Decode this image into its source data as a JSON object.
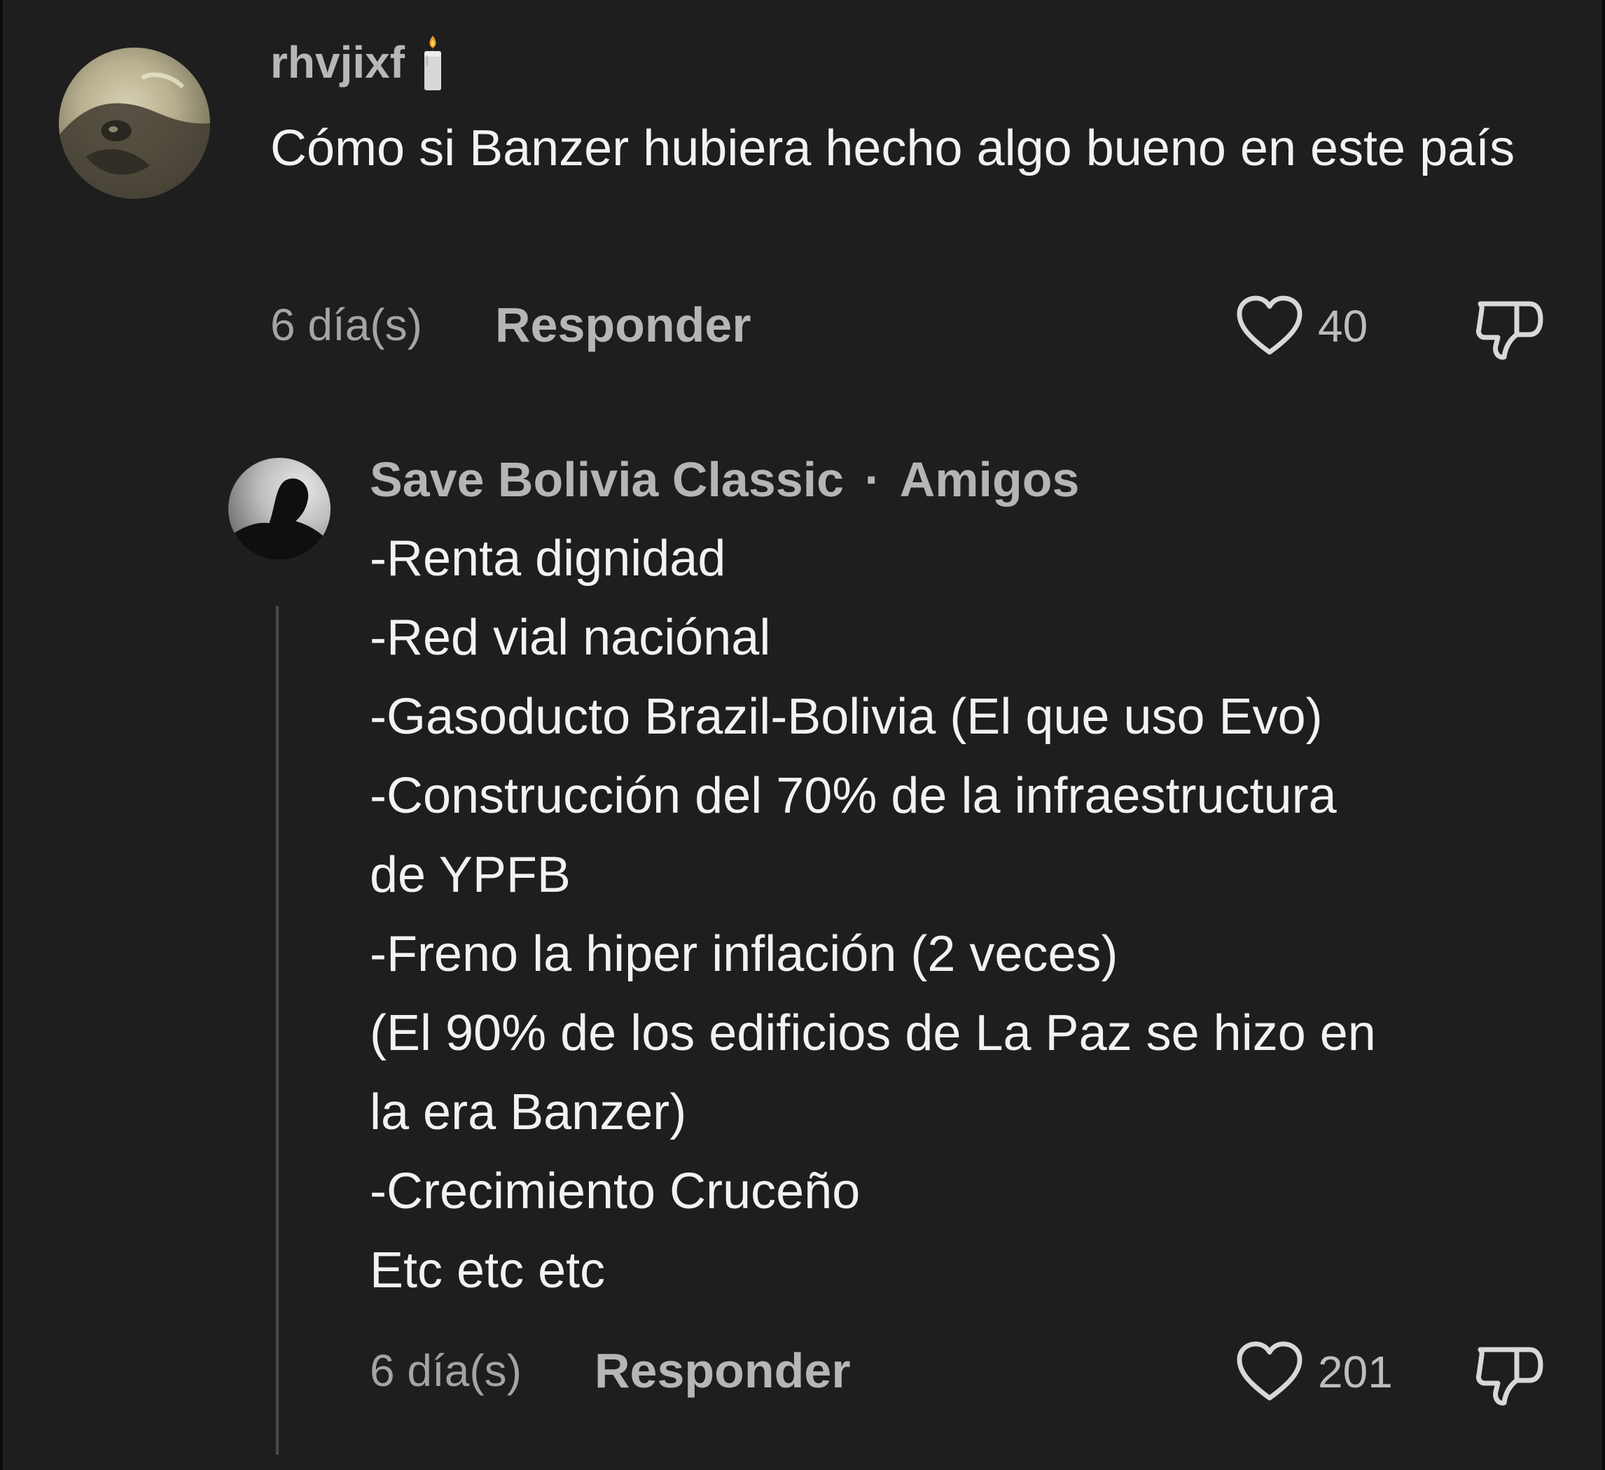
{
  "comment": {
    "username": "rhvjixf",
    "username_badge_icon": "candle-icon",
    "text": "Cómo si Banzer hubiera hecho algo bueno en este país",
    "time": "6 día(s)",
    "reply_label": "Responder",
    "likes": "40"
  },
  "reply": {
    "username": "Save Bolivia Classic",
    "separator": "·",
    "relation": "Amigos",
    "lines": [
      "-Renta dignidad",
      "-Red vial naciónal",
      "-Gasoducto Brazil-Bolivia (El que uso Evo)",
      "-Construcción del 70% de la infraestructura",
      "de YPFB",
      "-Freno la hiper inflación (2 veces)",
      "(El 90% de los edificios de La Paz se hizo en",
      "la era Banzer)",
      "-Crecimiento Cruceño",
      "Etc etc etc"
    ],
    "time": "6 día(s)",
    "reply_label": "Responder",
    "likes": "201"
  },
  "colors": {
    "background": "#1e1e1e",
    "primary_text": "#f2f2f2",
    "secondary_text": "#a4a4a4"
  }
}
